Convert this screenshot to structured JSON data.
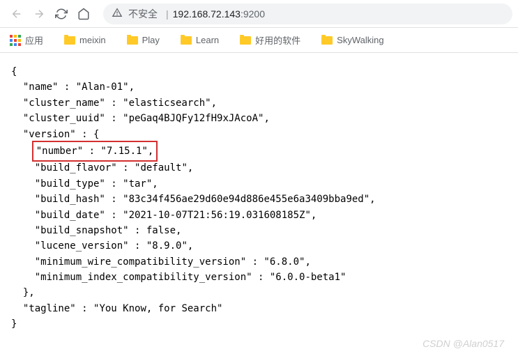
{
  "toolbar": {
    "secure_label": "不安全",
    "host": "192.168.72.143",
    "port": ":9200"
  },
  "bookmarks": {
    "apps_label": "应用",
    "items": [
      {
        "label": "meixin"
      },
      {
        "label": "Play"
      },
      {
        "label": "Learn"
      },
      {
        "label": "好用的软件"
      },
      {
        "label": "SkyWalking"
      }
    ]
  },
  "json_response": {
    "name": "Alan-01",
    "cluster_name": "elasticsearch",
    "cluster_uuid": "peGaq4BJQFy12fH9xJAcoA",
    "version": {
      "number": "7.15.1",
      "build_flavor": "default",
      "build_type": "tar",
      "build_hash": "83c34f456ae29d60e94d886e455e6a3409bba9ed",
      "build_date": "2021-10-07T21:56:19.031608185Z",
      "build_snapshot": "false",
      "lucene_version": "8.9.0",
      "minimum_wire_compatibility_version": "6.8.0",
      "minimum_index_compatibility_version": "6.0.0-beta1"
    },
    "tagline": "You Know, for Search"
  },
  "watermark": "CSDN @Alan0517"
}
